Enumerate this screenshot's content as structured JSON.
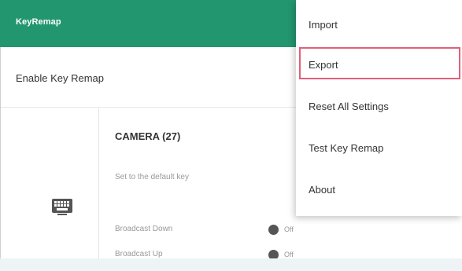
{
  "appbar": {
    "title": "KeyRemap"
  },
  "enable": {
    "label": "Enable Key Remap"
  },
  "card": {
    "title": "CAMERA (27)",
    "subtitle": "Set to the default key",
    "options": [
      {
        "label": "Broadcast Down",
        "state": "Off"
      },
      {
        "label": "Broadcast Up",
        "state": "Off"
      }
    ]
  },
  "menu": {
    "items": [
      {
        "label": "Import"
      },
      {
        "label": "Export",
        "highlighted": true
      },
      {
        "label": "Reset All Settings"
      },
      {
        "label": "Test Key Remap"
      },
      {
        "label": "About"
      }
    ]
  },
  "colors": {
    "appbar": "#22966f",
    "highlight_border": "#e0607a",
    "toggle_off": "#555555"
  }
}
